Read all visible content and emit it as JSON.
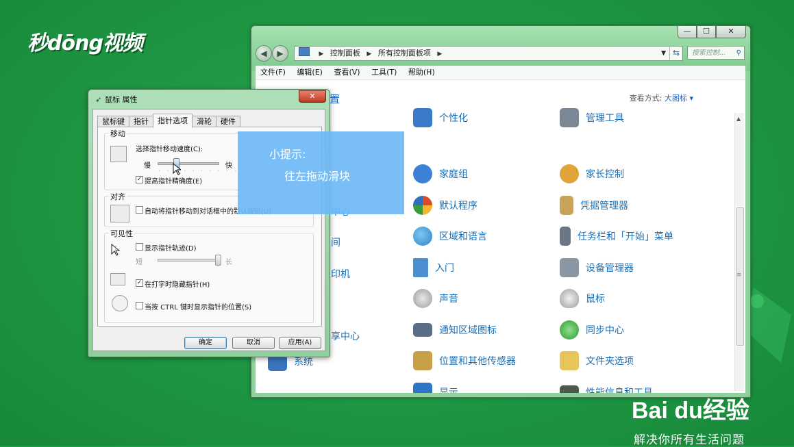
{
  "branding": {
    "logo_top": "秒dōng视频",
    "baidu_logo": "Bai du经验",
    "baidu_slogan": "解决你所有生活问题"
  },
  "control_panel": {
    "window_buttons": [
      "—",
      "☐",
      "✕"
    ],
    "breadcrumb": [
      "控制面板",
      "所有控制面板项"
    ],
    "search_placeholder": "搜索控制...",
    "menu": [
      "文件(F)",
      "编辑(E)",
      "查看(V)",
      "工具(T)",
      "帮助(H)"
    ],
    "title_fragment": "置",
    "view_label": "查看方式:",
    "view_value": "大图标 ▾",
    "partial_left_items": [
      "中心",
      "间",
      "印机",
      "享中心"
    ],
    "items_col1": [
      {
        "label": "个性化",
        "icon": "personalization-icon",
        "color": "#3a7ac8"
      },
      {
        "label": "家庭组",
        "icon": "homegroup-icon",
        "color": "#3b82d6"
      },
      {
        "label": "默认程序",
        "icon": "default-programs-icon",
        "color": "#d84c2b"
      },
      {
        "label": "区域和语言",
        "icon": "region-language-icon",
        "color": "#2f86c9"
      },
      {
        "label": "入门",
        "icon": "getting-started-icon",
        "color": "#4b8fd1"
      },
      {
        "label": "声音",
        "icon": "sound-icon",
        "color": "#a4a4a4"
      },
      {
        "label": "通知区域图标",
        "icon": "notification-area-icon",
        "color": "#5a6f87"
      },
      {
        "label": "位置和其他传感器",
        "icon": "location-sensor-icon",
        "color": "#c9a04a"
      },
      {
        "label": "显示",
        "icon": "display-icon",
        "color": "#2d74c4"
      }
    ],
    "items_col2": [
      {
        "label": "管理工具",
        "icon": "admin-tools-icon",
        "color": "#7a8896"
      },
      {
        "label": "家长控制",
        "icon": "parental-controls-icon",
        "color": "#e1a43a"
      },
      {
        "label": "凭据管理器",
        "icon": "credential-manager-icon",
        "color": "#c9a357"
      },
      {
        "label": "任务栏和「开始」菜单",
        "icon": "taskbar-icon",
        "color": "#6b7785"
      },
      {
        "label": "设备管理器",
        "icon": "device-manager-icon",
        "color": "#8a96a4"
      },
      {
        "label": "鼠标",
        "icon": "mouse-icon",
        "color": "#b8b8b8"
      },
      {
        "label": "同步中心",
        "icon": "sync-center-icon",
        "color": "#3daa3d"
      },
      {
        "label": "文件夹选项",
        "icon": "folder-options-icon",
        "color": "#e8c45a"
      },
      {
        "label": "性能信息和工具",
        "icon": "performance-icon",
        "color": "#4a5a4a"
      }
    ],
    "item_col0_bottom": {
      "label": "系统",
      "icon": "system-icon",
      "color": "#3a74bf"
    }
  },
  "mouse_dialog": {
    "title": "鼠标 属性",
    "close": "✕",
    "tabs": [
      "鼠标键",
      "指针",
      "指针选项",
      "滑轮",
      "硬件"
    ],
    "active_tab": 2,
    "motion": {
      "group": "移动",
      "speed_label": "选择指针移动速度(C):",
      "slow": "慢",
      "fast": "快",
      "speed_level": 0.3,
      "precision_label": "提高指针精确度(E)",
      "precision_checked": "✓"
    },
    "snap": {
      "group": "对齐",
      "label": "自动将指针移动到对话框中的默认按钮(U)",
      "checked": ""
    },
    "visibility": {
      "group": "可见性",
      "trails_label": "显示指针轨迹(D)",
      "trails_checked": "",
      "short": "短",
      "long": "长",
      "trails_level": 1.0,
      "hide_label": "在打字时隐藏指针(H)",
      "hide_checked": "✓",
      "ctrl_label": "当按 CTRL 键时显示指针的位置(S)",
      "ctrl_checked": ""
    },
    "buttons": {
      "ok": "确定",
      "cancel": "取消",
      "apply": "应用(A)"
    }
  },
  "tip": {
    "title": "小提示:",
    "body": "往左拖动滑块"
  }
}
